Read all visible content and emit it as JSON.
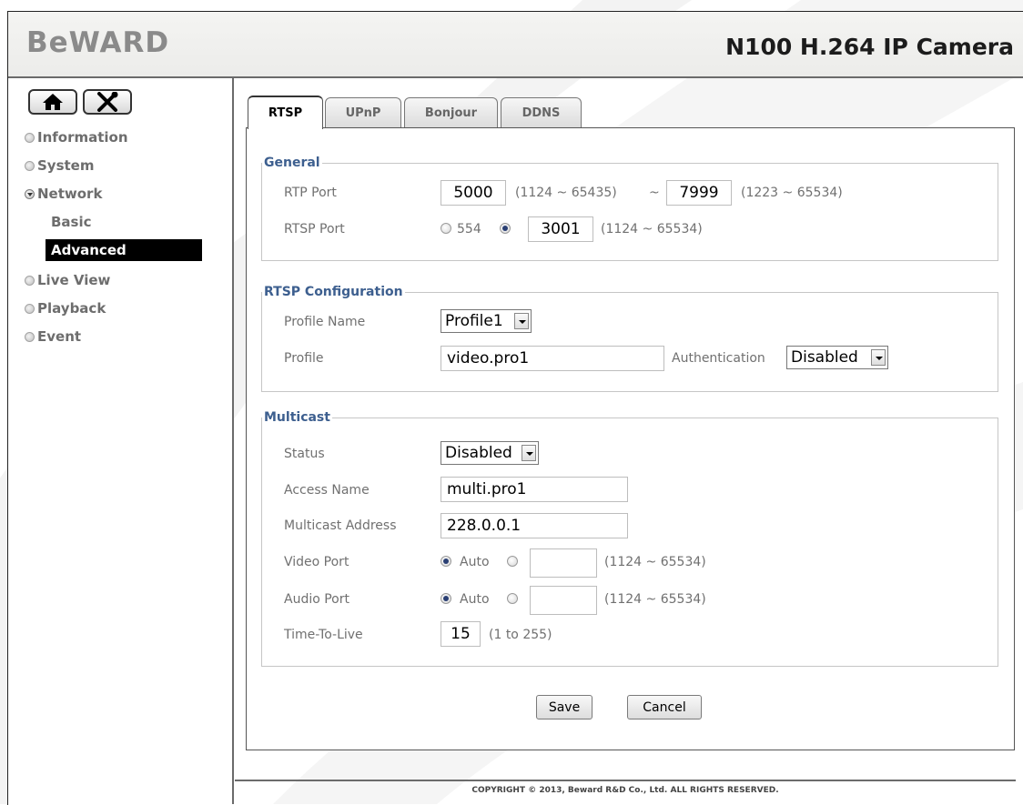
{
  "header": {
    "logo_text": "BeWARD",
    "camera_title": "N100 H.264 IP Camera"
  },
  "sidebar": {
    "tools": [
      {
        "icon": "home-icon"
      },
      {
        "icon": "tools-icon"
      }
    ],
    "items": [
      {
        "label": "Information",
        "expanded": false
      },
      {
        "label": "System",
        "expanded": false
      },
      {
        "label": "Network",
        "expanded": true
      },
      {
        "label": "Live View",
        "expanded": false
      },
      {
        "label": "Playback",
        "expanded": false
      },
      {
        "label": "Event",
        "expanded": false
      }
    ],
    "network_sub": [
      {
        "label": "Basic",
        "active": false
      },
      {
        "label": "Advanced",
        "active": true
      }
    ]
  },
  "tabs": [
    {
      "label": "RTSP",
      "active": true
    },
    {
      "label": "UPnP",
      "active": false
    },
    {
      "label": "Bonjour",
      "active": false
    },
    {
      "label": "DDNS",
      "active": false
    }
  ],
  "general": {
    "legend": "General",
    "rtp_port_label": "RTP Port",
    "rtp_port_start": "5000",
    "rtp_port_start_range": "(1124 ~ 65435)",
    "tilde": "~",
    "rtp_port_end": "7999",
    "rtp_port_end_range": "(1223 ~ 65534)",
    "rtsp_port_label": "RTSP Port",
    "rtsp_default_option": "554",
    "rtsp_default_selected": false,
    "rtsp_custom_selected": true,
    "rtsp_port_value": "3001",
    "rtsp_port_range": "(1124 ~ 65534)"
  },
  "rtsp_config": {
    "legend": "RTSP Configuration",
    "profile_name_label": "Profile Name",
    "profile_name_value": "Profile1",
    "profile_label": "Profile",
    "profile_value": "video.pro1",
    "authentication_label": "Authentication",
    "authentication_value": "Disabled"
  },
  "multicast": {
    "legend": "Multicast",
    "status_label": "Status",
    "status_value": "Disabled",
    "access_name_label": "Access Name",
    "access_name_value": "multi.pro1",
    "address_label": "Multicast Address",
    "address_value": "228.0.0.1",
    "video_port_label": "Video Port",
    "video_auto_label": "Auto",
    "video_auto_selected": true,
    "video_port_value": "",
    "video_port_range": "(1124 ~ 65534)",
    "audio_port_label": "Audio Port",
    "audio_auto_label": "Auto",
    "audio_auto_selected": true,
    "audio_port_value": "",
    "audio_port_range": "(1124 ~ 65534)",
    "ttl_label": "Time-To-Live",
    "ttl_value": "15",
    "ttl_range": "(1 to 255)"
  },
  "buttons": {
    "save": "Save",
    "cancel": "Cancel"
  },
  "footer": {
    "copyright": "COPYRIGHT © 2013, Beward R&D Co., Ltd. ALL RIGHTS RESERVED."
  }
}
